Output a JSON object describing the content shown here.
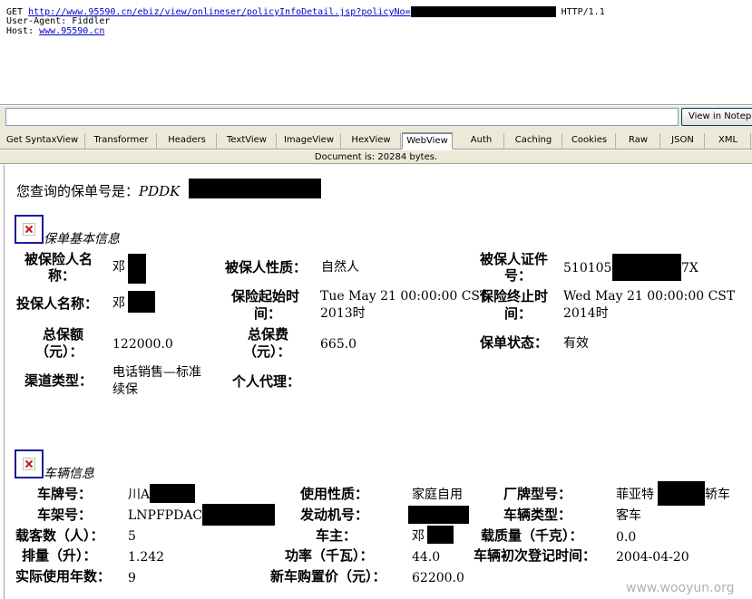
{
  "request": {
    "method": "GET",
    "url": "http://www.95590.cn/ebiz/view/onlineser/policyInfoDetail.jsp?policyNo=",
    "protocol": "HTTP/1.1",
    "user_agent": "User-Agent: Fiddler",
    "host_label": "Host:",
    "host": "www.95590.cn"
  },
  "find_bar": {
    "view_button": "View in Notepad"
  },
  "tabs": [
    "Get SyntaxView",
    "Transformer",
    "Headers",
    "TextView",
    "ImageView",
    "HexView",
    "WebView",
    "Auth",
    "Caching",
    "Cookies",
    "Raw",
    "JSON",
    "XML"
  ],
  "active_tab": "WebView",
  "status": "Document is: 20284 bytes.",
  "page": {
    "query_prefix": "您查询的保单号是：",
    "policy_prefix": "PDDK",
    "basic": {
      "title": "保单基本信息",
      "insured_name_label_1": "被保险人名",
      "insured_name_label_2": "称：",
      "insured_name": "邓",
      "insured_nature_label": "被保人性质：",
      "insured_nature": "自然人",
      "insured_id_label_1": "被保人证件",
      "insured_id_label_2": "号：",
      "insured_id_prefix": "510105",
      "insured_id_suffix": "7X",
      "applicant_label": "投保人名称：",
      "applicant_name": "邓",
      "start_label_1": "保险起始时",
      "start_label_2": "间：",
      "start_line_1": "Tue May 21 00:00:00 CST",
      "start_line_2": "2013时",
      "end_label_1": "保险终止时",
      "end_label_2": "间：",
      "end_line_1": "Wed May 21 00:00:00 CST",
      "end_line_2": "2014时",
      "sum_label_1": "总保额",
      "sum_label_2": "（元）：",
      "sum_value": "122000.0",
      "premium_label_1": "总保费",
      "premium_label_2": "（元）：",
      "premium_value": "665.0",
      "status_label": "保单状态：",
      "status_value": "有效",
      "channel_label": "渠道类型：",
      "channel_line_1": "电话销售—标准",
      "channel_line_2": "续保",
      "agent_label": "个人代理："
    },
    "vehicle": {
      "title": "车辆信息",
      "plate_label": "车牌号：",
      "plate_prefix": "川A",
      "usage_label": "使用性质：",
      "usage_value": "家庭自用",
      "model_label": "厂牌型号：",
      "model_prefix": "菲亚特",
      "model_suffix": "轿车",
      "frame_label": "车架号：",
      "frame_prefix": "LNPFPDAC",
      "engine_label": "发动机号：",
      "type_label": "车辆类型：",
      "type_value": "客车",
      "seats_label": "载客数（人）：",
      "seats_value": "5",
      "owner_label": "车主：",
      "owner_value": "邓",
      "load_label": "载质量（千克）：",
      "load_value": "0.0",
      "displacement_label": "排量（升）：",
      "displacement_value": "1.242",
      "power_label": "功率（千瓦）：",
      "power_value": "44.0",
      "register_label": "车辆初次登记时间：",
      "register_value": "2004-04-20",
      "years_label": "实际使用年数：",
      "years_value": "9",
      "price_label": "新车购置价（元）：",
      "price_value": "62200.0"
    }
  },
  "watermark": "www.wooyun.org"
}
